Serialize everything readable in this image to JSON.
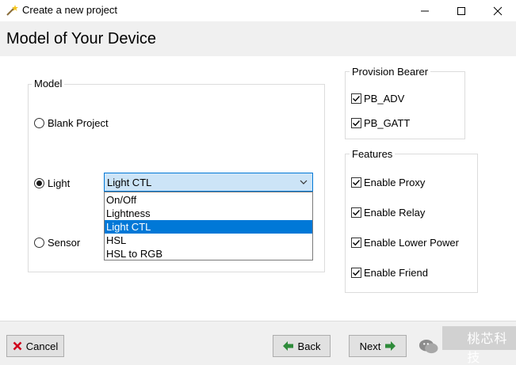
{
  "window": {
    "title": "Create a new project",
    "controls": {
      "minimize": "—",
      "maximize": "☐",
      "close": "✕"
    }
  },
  "header": {
    "title": "Model of Your Device"
  },
  "model": {
    "label": "Model",
    "options": [
      {
        "label": "Blank Project",
        "selected": false
      },
      {
        "label": "Light",
        "selected": true
      },
      {
        "label": "Sensor",
        "selected": false
      }
    ],
    "light_combo": {
      "value": "Light CTL",
      "items": [
        "On/Off",
        "Lightness",
        "Light CTL",
        "HSL",
        "HSL to RGB"
      ],
      "selected_index": 2
    }
  },
  "provision_bearer": {
    "label": "Provision Bearer",
    "items": [
      {
        "label": "PB_ADV",
        "checked": true
      },
      {
        "label": "PB_GATT",
        "checked": true
      }
    ]
  },
  "features": {
    "label": "Features",
    "items": [
      {
        "label": "Enable Proxy",
        "checked": true
      },
      {
        "label": "Enable Relay",
        "checked": true
      },
      {
        "label": "Enable Lower Power",
        "checked": true
      },
      {
        "label": "Enable Friend",
        "checked": true
      }
    ]
  },
  "footer": {
    "cancel": "Cancel",
    "back": "Back",
    "next": "Next"
  },
  "watermark": {
    "text": "桃芯科技"
  },
  "colors": {
    "accent": "#0078d7",
    "combo_bg": "#cce4f7",
    "cancel_icon": "#d0021b",
    "arrow_icon": "#2e8b3a"
  }
}
